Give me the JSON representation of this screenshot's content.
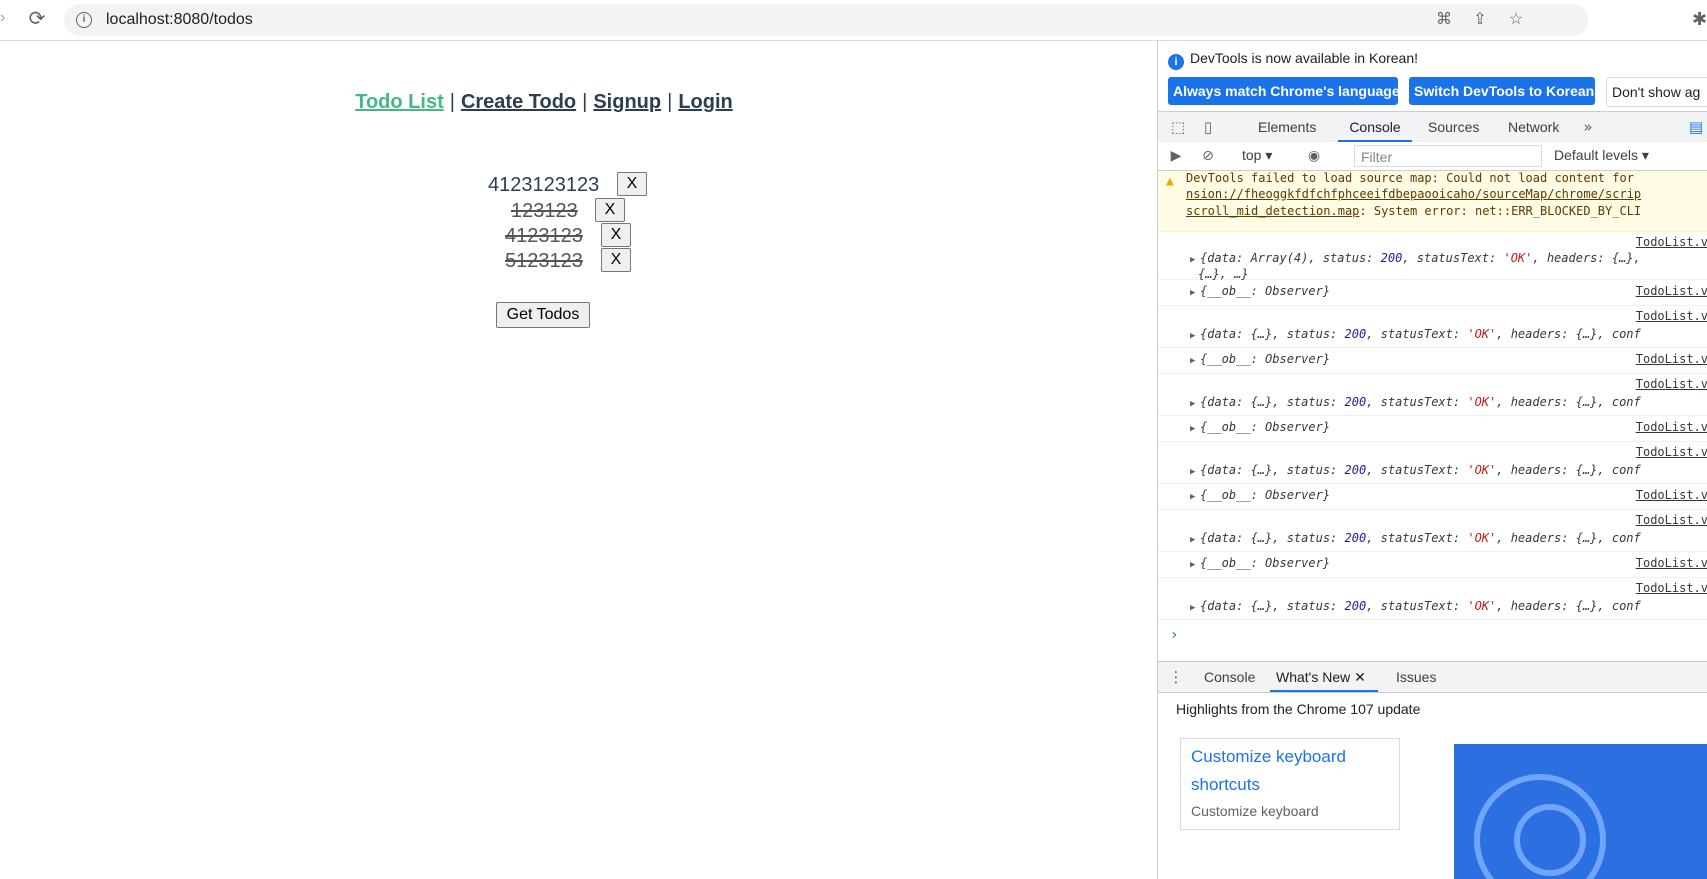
{
  "browser": {
    "url": "localhost:8080/todos"
  },
  "page": {
    "nav": {
      "todo_list": "Todo List",
      "create_todo": "Create Todo",
      "signup": "Signup",
      "login": "Login",
      "separator": "|"
    },
    "todos": [
      {
        "text": "4123123123",
        "done": false,
        "delete_label": "X"
      },
      {
        "text": "123123",
        "done": true,
        "delete_label": "X"
      },
      {
        "text": "4123123",
        "done": true,
        "delete_label": "X"
      },
      {
        "text": "5123123",
        "done": true,
        "delete_label": "X"
      }
    ],
    "get_todos_label": "Get Todos"
  },
  "devtools": {
    "notice": "DevTools is now available in Korean!",
    "lang_buttons": {
      "match": "Always match Chrome's language",
      "switch": "Switch DevTools to Korean",
      "dont_show": "Don't show ag"
    },
    "tabs": [
      "Elements",
      "Console",
      "Sources",
      "Network"
    ],
    "active_tab": "Console",
    "console_toolbar": {
      "context": "top",
      "filter_placeholder": "Filter",
      "levels": "Default levels"
    },
    "warning": {
      "line1": "DevTools failed to load source map: Could not load content for",
      "line2": "nsion://fheoggkfdfchfphceeifdbepaooicaho/sourceMap/chrome/scrip",
      "line3_link": "scroll_mid_detection.map",
      "line3_rest": ": System error: net::ERR_BLOCKED_BY_CLI"
    },
    "source_label": "TodoList.v",
    "messages": {
      "first_a": "{data: Array(4), status: ",
      "first_num": "200",
      "first_b": ", statusText: ",
      "first_str": "'OK'",
      "first_c": ", headers: {…},",
      "first_line2": "{…}, …}",
      "observer": "{__ob__: Observer}",
      "resp_a": "{data: {…}, status: ",
      "resp_num": "200",
      "resp_b": ", statusText: ",
      "resp_str": "'OK'",
      "resp_c": ", headers: {…}, conf"
    },
    "drawer": {
      "tabs": [
        "Console",
        "What's New",
        "Issues"
      ],
      "active": "What's New",
      "highlights": "Highlights from the Chrome 107 update",
      "card_title": "Customize keyboard shortcuts",
      "card_sub": "Customize keyboard"
    }
  }
}
